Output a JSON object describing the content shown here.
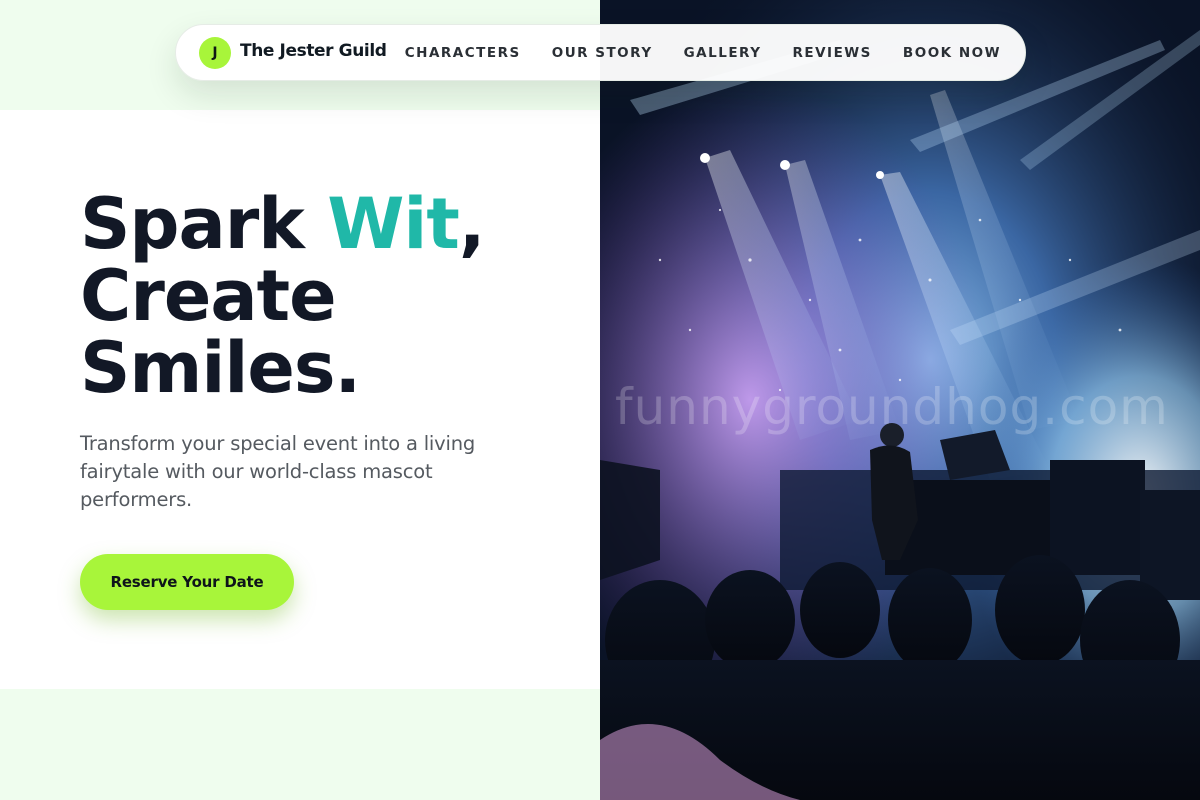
{
  "brand": {
    "logo_letter": "J",
    "name": "The Jester Guild"
  },
  "nav": {
    "items": [
      "CHARACTERS",
      "OUR STORY",
      "GALLERY",
      "REVIEWS",
      "BOOK NOW"
    ]
  },
  "hero": {
    "headline_part1": "Spark ",
    "headline_accent": "Wit",
    "headline_part2": ",",
    "headline_line2": "Create",
    "headline_line3": "Smiles.",
    "subtext": "Transform your special event into a living fairytale with our world-class mascot performers.",
    "cta_label": "Reserve Your Date"
  },
  "image": {
    "watermark": "funnygroundhog.com"
  },
  "colors": {
    "accent_lime": "#a8f53a",
    "accent_teal": "#20b8a8",
    "headline": "#121826",
    "band_mint": "#effdee"
  }
}
